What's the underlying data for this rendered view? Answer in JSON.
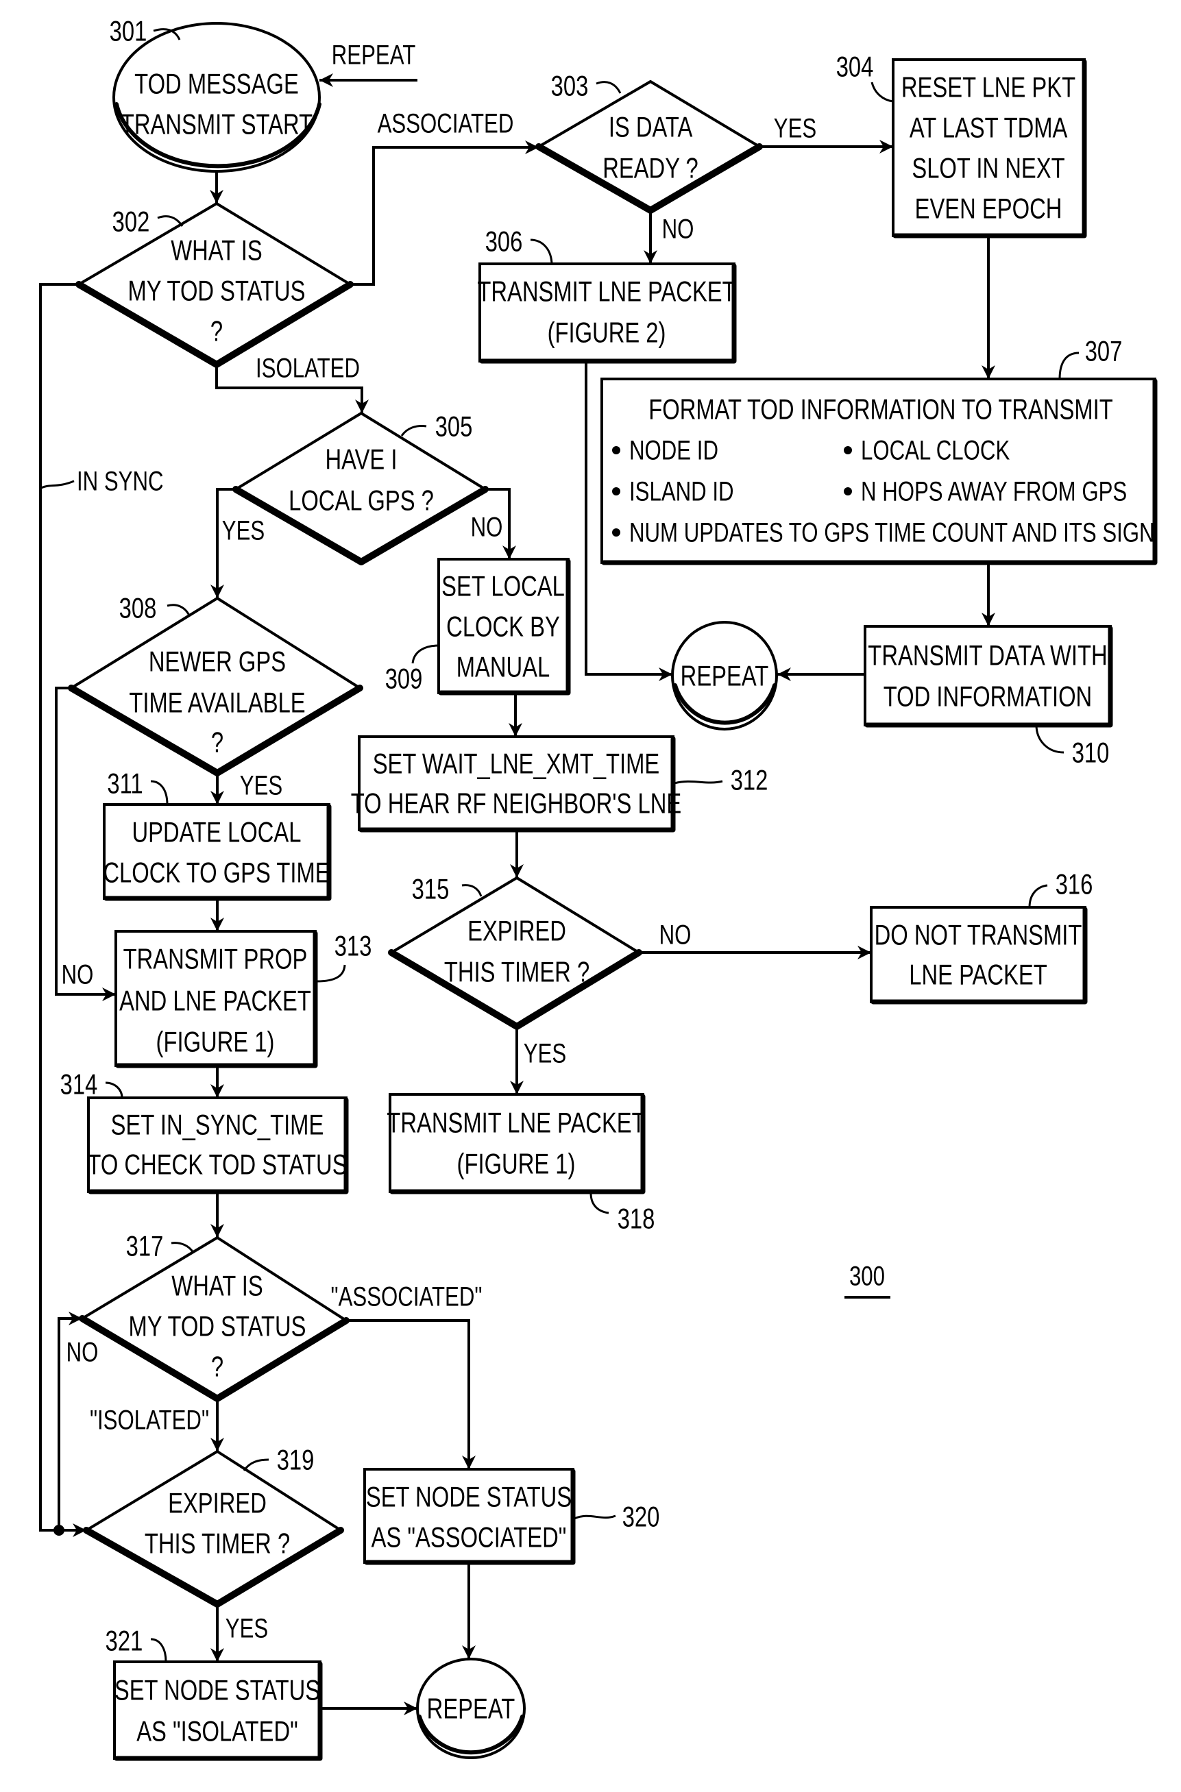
{
  "figure": {
    "number": "300"
  },
  "nodes": {
    "n301": {
      "ref": "301",
      "type": "terminator",
      "lines": [
        "TOD MESSAGE",
        "TRANSMIT START"
      ]
    },
    "n302": {
      "ref": "302",
      "type": "decision",
      "lines": [
        "WHAT IS",
        "MY TOD STATUS",
        "?"
      ]
    },
    "n303": {
      "ref": "303",
      "type": "decision",
      "lines": [
        "IS DATA",
        "READY ?"
      ]
    },
    "n304": {
      "ref": "304",
      "type": "process",
      "lines": [
        "RESET LNE PKT",
        "AT LAST TDMA",
        "SLOT IN NEXT",
        "EVEN EPOCH"
      ]
    },
    "n305": {
      "ref": "305",
      "type": "decision",
      "lines": [
        "HAVE I",
        "LOCAL GPS ?"
      ]
    },
    "n306": {
      "ref": "306",
      "type": "process",
      "lines": [
        "TRANSMIT LNE PACKET",
        "(FIGURE 2)"
      ]
    },
    "n307": {
      "ref": "307",
      "type": "process",
      "title": "FORMAT TOD INFORMATION TO TRANSMIT",
      "bullets": [
        "NODE ID",
        "LOCAL CLOCK",
        "ISLAND ID",
        "N HOPS AWAY FROM GPS",
        "NUM UPDATES TO GPS TIME COUNT AND ITS SIGN"
      ]
    },
    "n308": {
      "ref": "308",
      "type": "decision",
      "lines": [
        "NEWER GPS",
        "TIME AVAILABLE",
        "?"
      ]
    },
    "n309": {
      "ref": "309",
      "type": "process",
      "lines": [
        "SET LOCAL",
        "CLOCK BY",
        "MANUAL"
      ]
    },
    "n310": {
      "ref": "310",
      "type": "process",
      "lines": [
        "TRANSMIT DATA WITH",
        "TOD INFORMATION"
      ]
    },
    "n311": {
      "ref": "311",
      "type": "process",
      "lines": [
        "UPDATE LOCAL",
        "CLOCK TO GPS TIME"
      ]
    },
    "n312": {
      "ref": "312",
      "type": "process",
      "lines": [
        "SET WAIT_LNE_XMT_TIME",
        "TO HEAR RF NEIGHBOR'S LNE"
      ]
    },
    "n313": {
      "ref": "313",
      "type": "process",
      "lines": [
        "TRANSMIT PROP",
        "AND LNE PACKET",
        "(FIGURE 1)"
      ]
    },
    "n314": {
      "ref": "314",
      "type": "process",
      "lines": [
        "SET IN_SYNC_TIME",
        "TO CHECK TOD STATUS"
      ]
    },
    "n315": {
      "ref": "315",
      "type": "decision",
      "lines": [
        "EXPIRED",
        "THIS TIMER ?"
      ]
    },
    "n316": {
      "ref": "316",
      "type": "process",
      "lines": [
        "DO NOT TRANSMIT",
        "LNE PACKET"
      ]
    },
    "n317": {
      "ref": "317",
      "type": "decision",
      "lines": [
        "WHAT IS",
        "MY TOD STATUS",
        "?"
      ]
    },
    "n318": {
      "ref": "318",
      "type": "process",
      "lines": [
        "TRANSMIT LNE PACKET",
        "(FIGURE 1)"
      ]
    },
    "n319": {
      "ref": "319",
      "type": "decision",
      "lines": [
        "EXPIRED",
        "THIS TIMER ?"
      ]
    },
    "n320": {
      "ref": "320",
      "type": "process",
      "lines": [
        "SET NODE STATUS",
        "AS \"ASSOCIATED\""
      ]
    },
    "n321": {
      "ref": "321",
      "type": "process",
      "lines": [
        "SET NODE STATUS",
        "AS \"ISOLATED\""
      ]
    },
    "repeat_mid": {
      "type": "terminator",
      "label": "REPEAT"
    },
    "repeat_bottom": {
      "type": "terminator",
      "label": "REPEAT"
    }
  },
  "edges": {
    "repeat_in": "REPEAT",
    "e302_associated": "ASSOCIATED",
    "e302_isolated": "ISOLATED",
    "e302_in_sync": "IN SYNC",
    "e303_yes": "YES",
    "e303_no": "NO",
    "e305_yes": "YES",
    "e305_no": "NO",
    "e308_yes": "YES",
    "e308_no": "NO",
    "e315_no": "NO",
    "e315_yes": "YES",
    "e317_associated": "\"ASSOCIATED\"",
    "e317_isolated": "\"ISOLATED\"",
    "e319_no": "NO",
    "e319_yes": "YES"
  }
}
